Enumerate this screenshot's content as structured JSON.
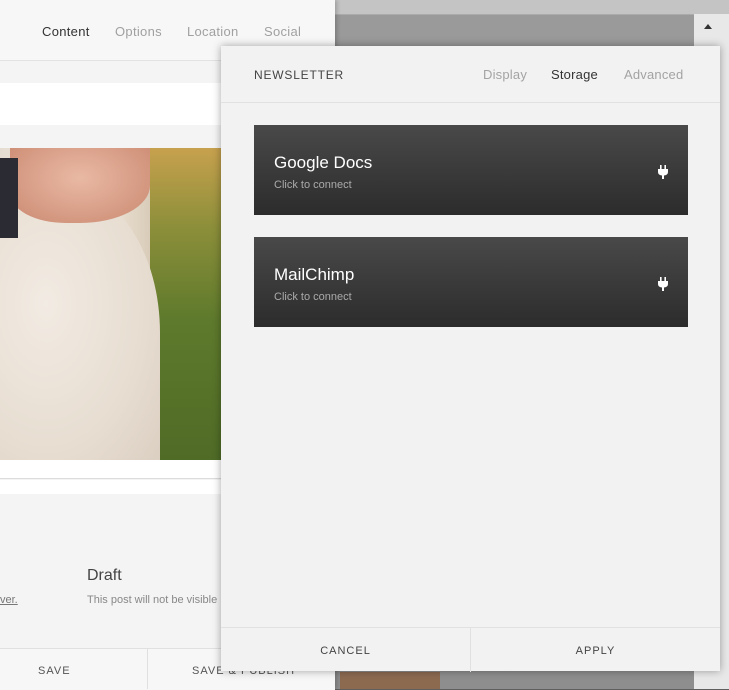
{
  "editor": {
    "tabs": [
      "Content",
      "Options",
      "Location",
      "Social"
    ],
    "active_tab": "Content",
    "partial_link": "ver.",
    "draft_title": "Draft",
    "draft_description": "This post will not be visible",
    "footer": {
      "save": "SAVE",
      "save_publish": "SAVE & PUBLISH"
    }
  },
  "panel": {
    "title": "NEWSLETTER",
    "tabs": [
      "Display",
      "Storage",
      "Advanced"
    ],
    "active_tab": "Storage",
    "services": [
      {
        "name": "Google Docs",
        "subtitle": "Click to connect",
        "icon": "plug-icon"
      },
      {
        "name": "MailChimp",
        "subtitle": "Click to connect",
        "icon": "plug-icon"
      }
    ],
    "footer": {
      "cancel": "CANCEL",
      "apply": "APPLY"
    }
  }
}
